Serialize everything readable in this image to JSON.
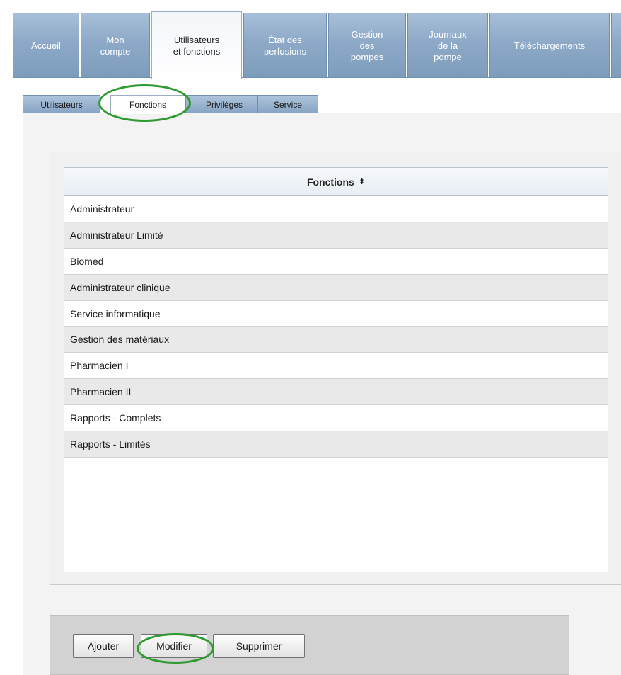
{
  "main_tabs": [
    {
      "label": "Accueil"
    },
    {
      "label": "Mon\ncompte"
    },
    {
      "label": "Utilisateurs\net fonctions",
      "active": true
    },
    {
      "label": "État des\nperfusions"
    },
    {
      "label": "Gestion\ndes\npompes"
    },
    {
      "label": "Journaux\nde la\npompe"
    },
    {
      "label": "Téléchargements"
    }
  ],
  "sub_tabs": [
    {
      "label": "Utilisateurs"
    },
    {
      "label": "Fonctions",
      "active": true
    },
    {
      "label": "Privilèges"
    },
    {
      "label": "Service"
    }
  ],
  "table": {
    "header": "Fonctions",
    "sort_glyph": "⬍",
    "rows": [
      "Administrateur",
      "Administrateur Limité",
      "Biomed",
      "Administrateur clinique",
      "Service informatique",
      "Gestion des matériaux",
      "Pharmacien I",
      "Pharmacien II",
      "Rapports - Complets",
      "Rapports - Limités"
    ]
  },
  "buttons": {
    "add": "Ajouter",
    "edit": "Modifier",
    "delete": "Supprimer"
  },
  "colors": {
    "tab_blue": "#8da9c7",
    "highlight_green": "#2f9a2f",
    "row_alt": "#e9e9e9"
  }
}
